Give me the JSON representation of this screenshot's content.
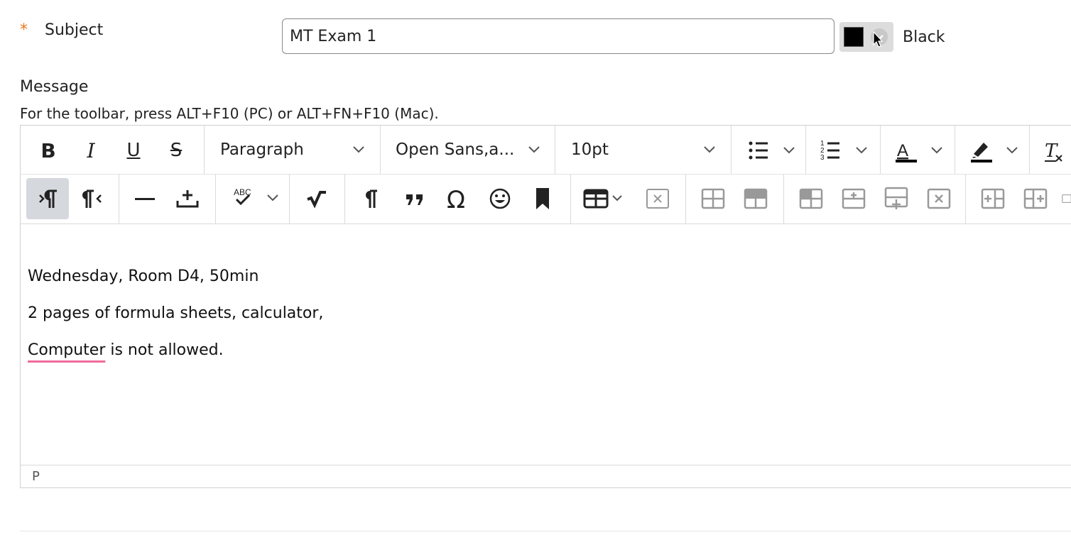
{
  "form": {
    "required_marker": "*",
    "subject_label": "Subject",
    "subject_value": "MT Exam 1",
    "color_value": "#000000",
    "color_name": "Black",
    "message_label": "Message",
    "toolbar_hint": "For the toolbar, press ALT+F10 (PC) or ALT+FN+F10 (Mac)."
  },
  "toolbar": {
    "row1": {
      "bold": "B",
      "italic": "I",
      "underline": "U",
      "strike": "S",
      "block_format": "Paragraph",
      "font_family": "Open Sans,a...",
      "font_size": "10pt",
      "icons": [
        "bold-icon",
        "italic-icon",
        "underline-icon",
        "strikethrough-icon",
        "bullet-list-icon",
        "numbered-list-icon",
        "text-color-icon",
        "highlight-icon",
        "clear-format-icon"
      ]
    },
    "row2": {
      "icons": [
        "ltr-icon",
        "rtl-icon",
        "horizontal-rule-icon",
        "insert-below-icon",
        "spellcheck-icon",
        "math-icon",
        "paragraph-mark-icon",
        "quote-icon",
        "omega-icon",
        "emoji-icon",
        "bookmark-icon",
        "table-icon",
        "delete-table-icon",
        "merge-cells-icon",
        "split-cells-icon",
        "cell-props-icon",
        "insert-row-before-icon",
        "insert-row-after-icon",
        "delete-row-icon",
        "insert-col-before-icon",
        "insert-col-after-icon"
      ],
      "spell_abc": "ABC"
    }
  },
  "editor": {
    "paragraphs": [
      "Wednesday, Room D4, 50min",
      "2 pages of formula sheets, calculator,"
    ],
    "p3_misspelled": "Computer",
    "p3_rest": " is not allowed.",
    "status_path": "P"
  },
  "colors": {
    "accent_required": "#e8791e",
    "spellcheck_underline": "#f06b9c",
    "active_button_bg": "#d5d8dd"
  }
}
